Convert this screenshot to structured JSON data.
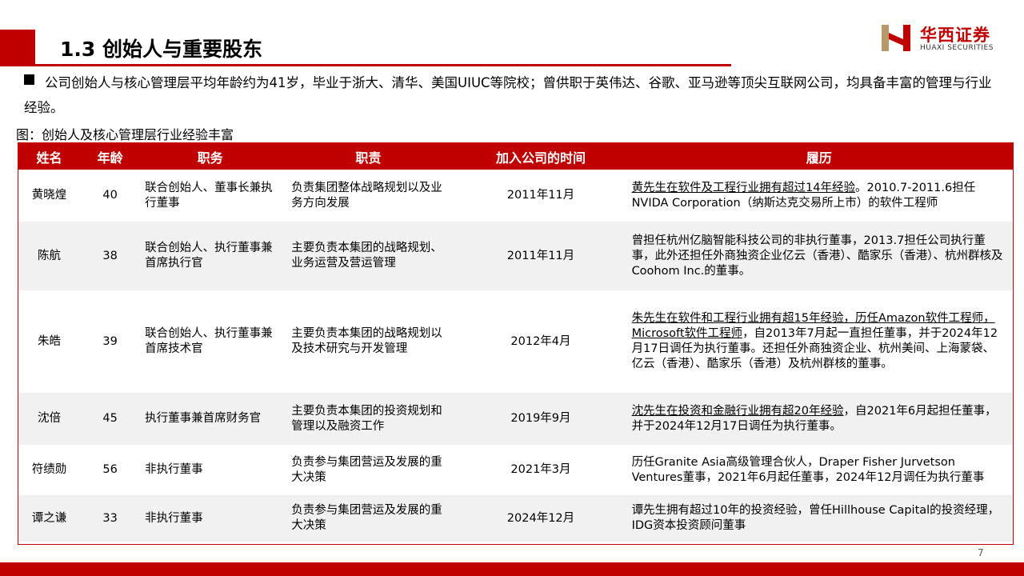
{
  "header": {
    "title": "1.3 创始人与重要股东",
    "logo_cn": "华西证券",
    "logo_en": "HUAXI SECURITIES",
    "brand_color": "#c00000"
  },
  "intro": {
    "bullet_icon": "square-bullet",
    "text": "公司创始人与核心管理层平均年龄约为41岁，毕业于浙大、清华、美国UIUC等院校；曾供职于英伟达、谷歌、亚马逊等顶尖互联网公司，均具备丰富的管理与行业经验。"
  },
  "caption": "图：创始人及核心管理层行业经验丰富",
  "table": {
    "headers": [
      "姓名",
      "年龄",
      "职务",
      "职责",
      "加入公司的时间",
      "履历"
    ],
    "rows": [
      {
        "name": "黄晓煌",
        "age": "40",
        "title": "联合创始人、董事长兼执行董事",
        "duty": "负责集团整体战略规划以及业务方向发展",
        "joined": "2011年11月",
        "bio_u": "黄先生在软件及工程行业拥有超过14年经验",
        "bio": "。2010.7-2011.6担任NVIDA Corporation（纳斯达克交易所上市）的软件工程师"
      },
      {
        "name": "陈航",
        "age": "38",
        "title": "联合创始人、执行董事兼首席执行官",
        "duty": "主要负责本集团的战略规划、业务运营及营运管理",
        "joined": "2011年11月",
        "bio_u": "",
        "bio": "曾担任杭州亿脑智能科技公司的非执行董事，2013.7担任公司执行董事，此外还担任外商独资企业亿云（香港）、酷家乐（香港）、杭州群核及Coohom Inc.的董事。"
      },
      {
        "name": "朱皓",
        "age": "39",
        "title": "联合创始人、执行董事兼首席技术官",
        "duty": "主要负责本集团的战略规划以及技术研究与开发管理",
        "joined": "2012年4月",
        "bio_u": "朱先生在软件和工程行业拥有超15年经验，历任Amazon软件工程师，Microsoft软件工程师",
        "bio": "，自2013年7月起一直担任董事，并于2024年12月17日调任为执行董事。还担任外商独资企业、杭州美间、上海蒙袋、亿云（香港）、酷家乐（香港）及杭州群核的董事。"
      },
      {
        "name": "沈倍",
        "age": "45",
        "title": "执行董事兼首席财务官",
        "duty": "主要负责本集团的投资规划和管理以及融资工作",
        "joined": "2019年9月",
        "bio_u": "沈先生在投资和金融行业拥有超20年经验",
        "bio": "，自2021年6月起担任董事，并于2024年12月17日调任为执行董事。"
      },
      {
        "name": "符绩勋",
        "age": "56",
        "title": "非执行董事",
        "duty": "负责参与集团营运及发展的重大决策",
        "joined": "2021年3月",
        "bio_u": "",
        "bio": "历任Granite Asia高级管理合伙人，Draper Fisher Jurvetson Ventures董事，2021年6月起任董事，2024年12月调任为执行董事"
      },
      {
        "name": "谭之谦",
        "age": "33",
        "title": "非执行董事",
        "duty": "负责参与集团营运及发展的重大决策",
        "joined": "2024年12月",
        "bio_u": "",
        "bio": "谭先生拥有超过10年的投资经验，曾任Hillhouse Capital的投资经理，IDG资本投资顾问董事"
      }
    ]
  },
  "footer": {
    "page_number": "7"
  }
}
